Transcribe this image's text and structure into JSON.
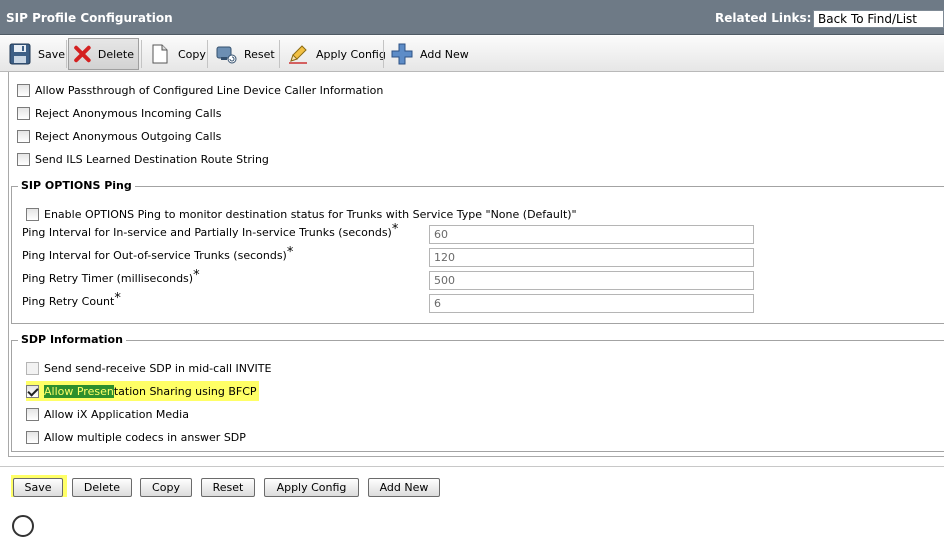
{
  "header": {
    "title": "SIP Profile Configuration",
    "related_links_label": "Related Links:",
    "related_links_value": "Back To Find/List"
  },
  "toolbar": {
    "save": "Save",
    "delete": "Delete",
    "copy": "Copy",
    "reset": "Reset",
    "apply_config": "Apply Config",
    "add_new": "Add New"
  },
  "top_options": [
    "Allow Passthrough of Configured Line Device Caller Information",
    "Reject Anonymous Incoming Calls",
    "Reject Anonymous Outgoing Calls",
    "Send ILS Learned Destination Route String"
  ],
  "options_ping": {
    "legend": "SIP OPTIONS Ping",
    "enable_label": "Enable OPTIONS Ping to monitor destination status for Trunks with Service Type \"None (Default)\"",
    "fields": [
      {
        "label": "Ping Interval for In-service and Partially In-service Trunks (seconds)",
        "required": "*",
        "value": "60"
      },
      {
        "label": "Ping Interval for Out-of-service Trunks (seconds)",
        "required": "*",
        "value": "120"
      },
      {
        "label": "Ping Retry Timer (milliseconds)",
        "required": "*",
        "value": "500"
      },
      {
        "label": "Ping Retry Count",
        "required": "*",
        "value": "6"
      }
    ]
  },
  "sdp": {
    "legend": "SDP Information",
    "items": [
      {
        "label": "Send send-receive SDP in mid-call INVITE"
      },
      {
        "label_part1": "Allow Presen",
        "label_part2": "tation Sharing using BFCP"
      },
      {
        "label": "Allow iX Application Media"
      },
      {
        "label": "Allow multiple codecs in answer SDP"
      }
    ]
  },
  "bottom_buttons": {
    "save": "Save",
    "delete": "Delete",
    "copy": "Copy",
    "reset": "Reset",
    "apply_config": "Apply Config",
    "add_new": "Add New"
  },
  "icons": {
    "save": "floppy-disk-icon",
    "delete": "red-x-icon",
    "copy": "copy-page-icon",
    "reset": "reset-icon",
    "apply_config": "pencil-icon",
    "add_new": "plus-icon",
    "info": "info-icon"
  },
  "colors": {
    "title_bar": "#6e7a86",
    "highlight": "#ffff66",
    "highlight_green": "#2d8f2d"
  }
}
